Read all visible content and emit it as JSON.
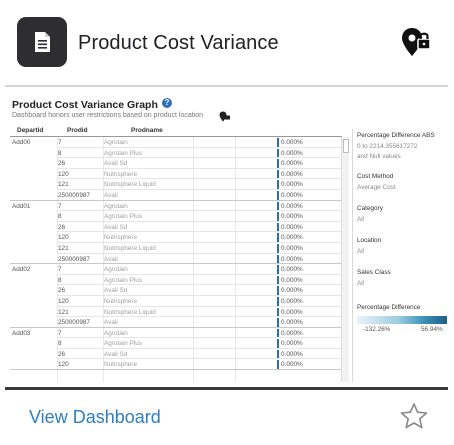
{
  "card": {
    "title": "Product Cost Variance",
    "badge_icon": "document-icon",
    "location_icon": "map-pin-lock-icon",
    "view_link": "View Dashboard",
    "favorite_icon": "star-outline-icon",
    "link_color": "#2d7ec4"
  },
  "thumbnail": {
    "title": "Product Cost Variance Graph",
    "help_icon": "info-circle-icon",
    "help_glyph": "?",
    "subtitle": "Dashboard honors user restrictions based on product location",
    "columns": {
      "dept": "Departid",
      "prod": "Prodid",
      "name": "Prodname"
    },
    "groups": [
      {
        "dept": "Add00",
        "rows": [
          {
            "prod": "7",
            "name": "Agrotain",
            "pct": "0.000%"
          },
          {
            "prod": "8",
            "name": "Agrotain Plus",
            "pct": "0.000%"
          },
          {
            "prod": "26",
            "name": "Avail Sd",
            "pct": "0.000%"
          },
          {
            "prod": "120",
            "name": "Nutrisphere",
            "pct": "0.000%"
          },
          {
            "prod": "121",
            "name": "Nutrisphere Liquid",
            "pct": "0.000%"
          },
          {
            "prod": "250000987",
            "name": "Avail",
            "pct": "0.000%"
          }
        ]
      },
      {
        "dept": "Add01",
        "rows": [
          {
            "prod": "7",
            "name": "Agrotain",
            "pct": "0.000%"
          },
          {
            "prod": "8",
            "name": "Agrotain Plus",
            "pct": "0.000%"
          },
          {
            "prod": "26",
            "name": "Avail Sd",
            "pct": "0.000%"
          },
          {
            "prod": "120",
            "name": "Nutrisphere",
            "pct": "0.000%"
          },
          {
            "prod": "121",
            "name": "Nutrisphere Liquid",
            "pct": "0.000%"
          },
          {
            "prod": "250000987",
            "name": "Avail",
            "pct": "0.000%"
          }
        ]
      },
      {
        "dept": "Add02",
        "rows": [
          {
            "prod": "7",
            "name": "Agrotain",
            "pct": "0.000%"
          },
          {
            "prod": "8",
            "name": "Agrotain Plus",
            "pct": "0.000%"
          },
          {
            "prod": "26",
            "name": "Avail Sd",
            "pct": "0.000%"
          },
          {
            "prod": "120",
            "name": "Nutrisphere",
            "pct": "0.000%"
          },
          {
            "prod": "121",
            "name": "Nutrisphere Liquid",
            "pct": "0.000%"
          },
          {
            "prod": "250000987",
            "name": "Avail",
            "pct": "0.000%"
          }
        ]
      },
      {
        "dept": "Add03",
        "rows": [
          {
            "prod": "7",
            "name": "Agrotain",
            "pct": "0.000%"
          },
          {
            "prod": "8",
            "name": "Agrotain Plus",
            "pct": "0.000%"
          },
          {
            "prod": "26",
            "name": "Avail Sd",
            "pct": "0.000%"
          },
          {
            "prod": "120",
            "name": "Nutrisphere",
            "pct": "0.000%"
          }
        ]
      }
    ],
    "filters": {
      "pct_abs_label": "Percentage Difference ABS",
      "pct_abs_value1": "0 to 2214.355617272",
      "pct_abs_value2": "and Null values",
      "cost_method_label": "Cost Method",
      "cost_method_value": "Average Cost",
      "category_label": "Category",
      "category_value": "All",
      "location_label": "Location",
      "location_value": "All",
      "sales_class_label": "Sales Class",
      "sales_class_value": "All",
      "pct_diff_label": "Percentage Difference",
      "pct_diff_min": "-132.26%",
      "pct_diff_max": "56.94%"
    }
  }
}
